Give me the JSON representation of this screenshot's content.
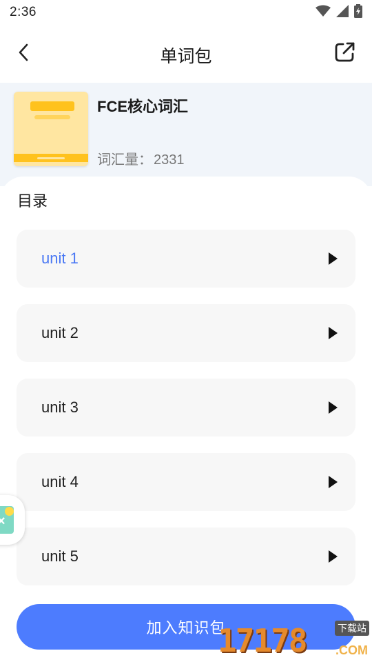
{
  "status_bar": {
    "time": "2:36",
    "icons": [
      "wifi-icon",
      "signal-icon",
      "battery-charging-icon"
    ]
  },
  "header": {
    "title": "单词包",
    "back_icon": "chevron-left-icon",
    "share_icon": "external-link-icon"
  },
  "book": {
    "title": "FCE核心词汇",
    "count_label": "词汇量：",
    "count_value": "2331"
  },
  "catalog": {
    "title": "目录",
    "units": [
      {
        "label": "unit 1",
        "active": true
      },
      {
        "label": "unit 2",
        "active": false
      },
      {
        "label": "unit 3",
        "active": false
      },
      {
        "label": "unit 4",
        "active": false
      },
      {
        "label": "unit 5",
        "active": false
      }
    ]
  },
  "join_button": {
    "label": "加入知识包"
  },
  "watermark": {
    "digits": "17178",
    "badge": "下载站",
    "suffix": ".COM"
  },
  "colors": {
    "accent": "#4d7cfe",
    "active_text": "#4a78f4",
    "info_bg": "#f1f5fa",
    "card_bg": "#f7f7f7",
    "cover_yellow": "#ffc21d"
  }
}
